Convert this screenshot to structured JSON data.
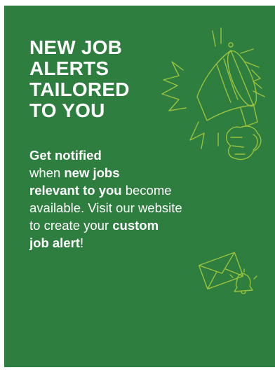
{
  "headline": {
    "lines": [
      "NEW JOB",
      "ALERTS",
      "TAILORED",
      "TO YOU"
    ]
  },
  "body": {
    "line1_bold": "Get notified",
    "line2_pre": "when ",
    "line2_bold": "new jobs",
    "line3_bold": "relevant to you",
    "line3_post": " become",
    "line4": "available. Visit our website",
    "line5_pre": "to create your ",
    "line5_bold": "custom",
    "line6_bold": "job alert",
    "line6_post": "!"
  },
  "colors": {
    "background": "#2d7e3f",
    "text": "#ffffff",
    "accent_line": "#9bc23c"
  },
  "icons": [
    "megaphone-icon",
    "envelope-icon",
    "bell-icon"
  ]
}
